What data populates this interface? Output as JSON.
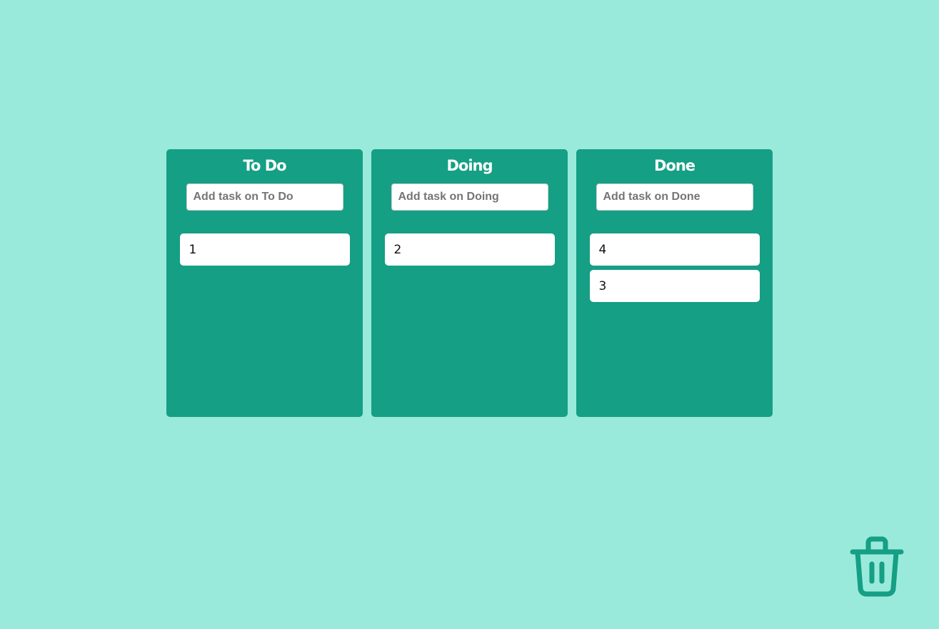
{
  "columns": [
    {
      "title": "To Do",
      "placeholder": "Add task on To Do",
      "tasks": [
        "1"
      ]
    },
    {
      "title": "Doing",
      "placeholder": "Add task on Doing",
      "tasks": [
        "2"
      ]
    },
    {
      "title": "Done",
      "placeholder": "Add task on Done",
      "tasks": [
        "4",
        "3"
      ]
    }
  ],
  "trash": {
    "icon": "trash-icon"
  },
  "colors": {
    "background": "#9aeadb",
    "column": "#159f85",
    "card": "#ffffff"
  }
}
